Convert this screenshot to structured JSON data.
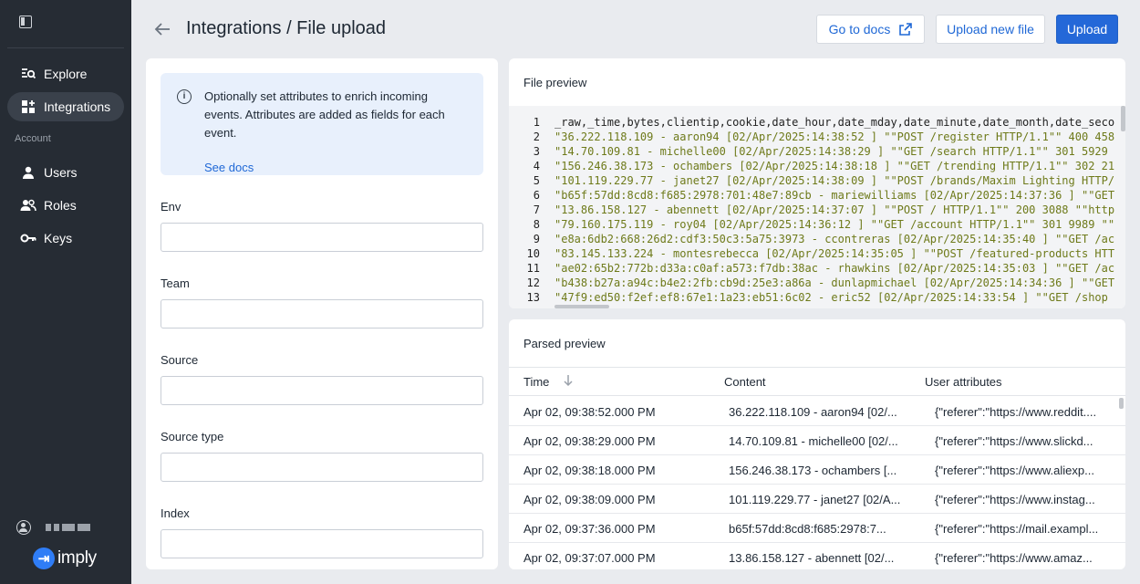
{
  "sidebar": {
    "nav": [
      {
        "label": "Explore",
        "icon": "explore-icon"
      },
      {
        "label": "Integrations",
        "icon": "integrations-icon"
      }
    ],
    "section_label": "Account",
    "account_nav": [
      {
        "label": "Users",
        "icon": "user-icon"
      },
      {
        "label": "Roles",
        "icon": "roles-icon"
      },
      {
        "label": "Keys",
        "icon": "key-icon"
      }
    ],
    "logo_text": "imply"
  },
  "header": {
    "title": "Integrations / File upload",
    "docs_button": "Go to docs",
    "upload_new_button": "Upload new file",
    "upload_button": "Upload"
  },
  "form": {
    "info_text": "Optionally set attributes to enrich incoming events. Attributes are added as fields for each event.",
    "info_link": "See docs",
    "fields": [
      {
        "label": "Env",
        "value": ""
      },
      {
        "label": "Team",
        "value": ""
      },
      {
        "label": "Source",
        "value": ""
      },
      {
        "label": "Source type",
        "value": ""
      },
      {
        "label": "Index",
        "value": ""
      }
    ]
  },
  "file_preview": {
    "title": "File preview",
    "lines": [
      {
        "n": "1",
        "text": "_raw,_time,bytes,clientip,cookie,date_hour,date_mday,date_minute,date_month,date_seco"
      },
      {
        "n": "2",
        "text": "\"36.222.118.109 - aaron94 [02/Apr/2025:14:38:52 ] \"\"POST /register HTTP/1.1\"\" 400 458"
      },
      {
        "n": "3",
        "text": "\"14.70.109.81 - michelle00 [02/Apr/2025:14:38:29 ] \"\"GET /search HTTP/1.1\"\" 301 5929"
      },
      {
        "n": "4",
        "text": "\"156.246.38.173 - ochambers [02/Apr/2025:14:38:18 ] \"\"GET /trending HTTP/1.1\"\" 302 21"
      },
      {
        "n": "5",
        "text": "\"101.119.229.77 - janet27 [02/Apr/2025:14:38:09 ] \"\"POST /brands/Maxim Lighting HTTP/"
      },
      {
        "n": "6",
        "text": "\"b65f:57dd:8cd8:f685:2978:701:48e7:89cb - mariewilliams [02/Apr/2025:14:37:36 ] \"\"GET"
      },
      {
        "n": "7",
        "text": "\"13.86.158.127 - abennett [02/Apr/2025:14:37:07 ] \"\"POST / HTTP/1.1\"\" 200 3088 \"\"http"
      },
      {
        "n": "8",
        "text": "\"79.160.175.119 - roy04 [02/Apr/2025:14:36:12 ] \"\"GET /account HTTP/1.1\"\" 301 9989 \"\""
      },
      {
        "n": "9",
        "text": "\"e8a:6db2:668:26d2:cdf3:50c3:5a75:3973 - ccontreras [02/Apr/2025:14:35:40 ] \"\"GET /ac"
      },
      {
        "n": "10",
        "text": "\"83.145.133.224 - montesrebecca [02/Apr/2025:14:35:05 ] \"\"POST /featured-products HTT"
      },
      {
        "n": "11",
        "text": "\"ae02:65b2:772b:d33a:c0af:a573:f7db:38ac - rhawkins [02/Apr/2025:14:35:03 ] \"\"GET /ac"
      },
      {
        "n": "12",
        "text": "\"b438:b27a:a94c:b4e2:2fb:cb9d:25e3:a86a - dunlapmichael [02/Apr/2025:14:34:36 ] \"\"GET"
      },
      {
        "n": "13",
        "text": "\"47f9:ed50:f2ef:ef8:67e1:1a23:eb51:6c02 - eric52 [02/Apr/2025:14:33:54 ] \"\"GET /shop"
      }
    ]
  },
  "parsed_preview": {
    "title": "Parsed preview",
    "columns": [
      "Time",
      "Content",
      "User attributes"
    ],
    "rows": [
      [
        "Apr 02, 09:38:52.000 PM",
        "36.222.118.109 - aaron94 [02/...",
        "{\"referer\":\"https://www.reddit...."
      ],
      [
        "Apr 02, 09:38:29.000 PM",
        "14.70.109.81 - michelle00 [02/...",
        "{\"referer\":\"https://www.slickd..."
      ],
      [
        "Apr 02, 09:38:18.000 PM",
        "156.246.38.173 - ochambers [...",
        "{\"referer\":\"https://www.aliexp..."
      ],
      [
        "Apr 02, 09:38:09.000 PM",
        "101.119.229.77 - janet27 [02/A...",
        "{\"referer\":\"https://www.instag..."
      ],
      [
        "Apr 02, 09:37:36.000 PM",
        "b65f:57dd:8cd8:f685:2978:7...",
        "{\"referer\":\"https://mail.exampl..."
      ],
      [
        "Apr 02, 09:37:07.000 PM",
        "13.86.158.127 - abennett [02/...",
        "{\"referer\":\"https://www.amaz..."
      ]
    ]
  }
}
